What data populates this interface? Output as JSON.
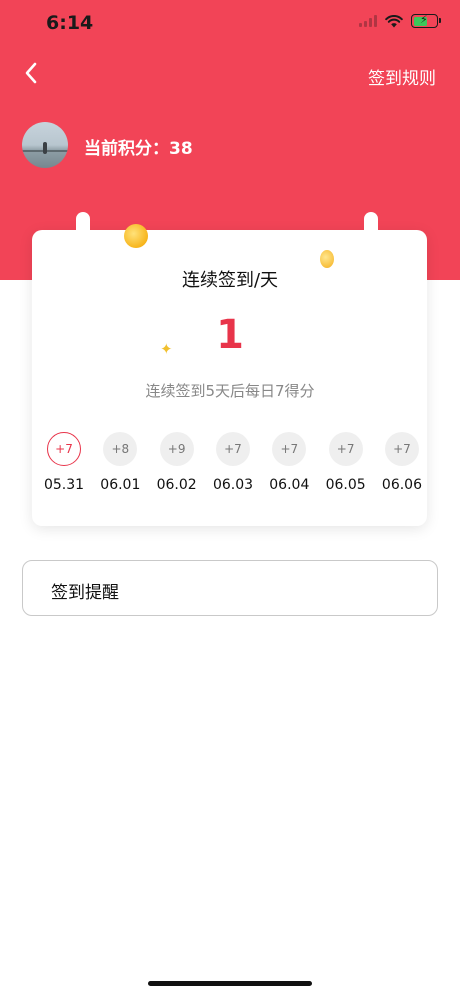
{
  "status_bar": {
    "time": "6:14"
  },
  "nav": {
    "rules_label": "签到规则"
  },
  "profile": {
    "points_label": "当前积分：38"
  },
  "card": {
    "title": "连续签到/天",
    "streak_days": "1",
    "note": "连续签到5天后每日7得分"
  },
  "days": [
    {
      "points": "+7",
      "date": "05.31",
      "checked": true
    },
    {
      "points": "+8",
      "date": "06.01",
      "checked": false
    },
    {
      "points": "+9",
      "date": "06.02",
      "checked": false
    },
    {
      "points": "+7",
      "date": "06.03",
      "checked": false
    },
    {
      "points": "+7",
      "date": "06.04",
      "checked": false
    },
    {
      "points": "+7",
      "date": "06.05",
      "checked": false
    },
    {
      "points": "+7",
      "date": "06.06",
      "checked": false
    }
  ],
  "reminder": {
    "label": "签到提醒"
  },
  "colors": {
    "header": "#f24457",
    "accent": "#e8344a",
    "badge_inactive": "#efefef"
  },
  "icons": {
    "back": "chevron-left-icon",
    "wifi": "wifi-icon",
    "battery": "battery-charging-icon",
    "signal": "cellular-signal-icon"
  }
}
